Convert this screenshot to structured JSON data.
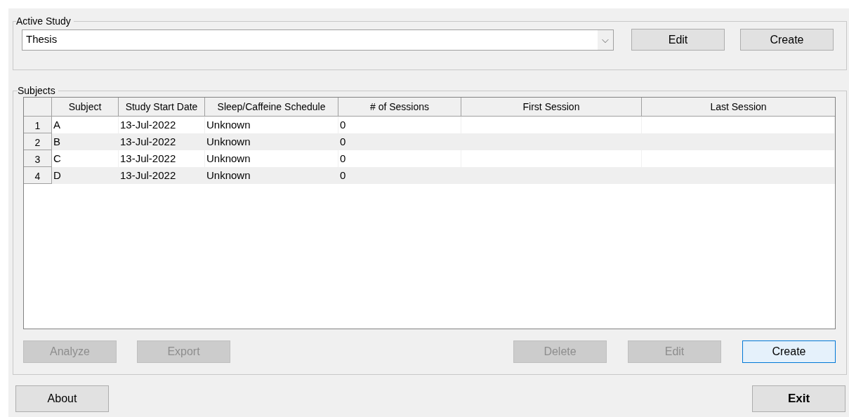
{
  "active_study": {
    "legend": "Active Study",
    "value": "Thesis",
    "dropdown_icon": "⌵",
    "buttons": [
      {
        "label": "Edit",
        "disabled": false,
        "focused": false
      },
      {
        "label": "Create",
        "disabled": false,
        "focused": false
      }
    ]
  },
  "subjects": {
    "legend": "Subjects",
    "table": {
      "columns": [
        "Subject",
        "Study Start Date",
        "Sleep/Caffeine Schedule",
        "# of Sessions",
        "First Session",
        "Last Session"
      ],
      "rows": [
        {
          "number": "1",
          "cells": [
            "A",
            "13-Jul-2022",
            "Unknown",
            "0",
            "",
            ""
          ]
        },
        {
          "number": "2",
          "cells": [
            "B",
            "13-Jul-2022",
            "Unknown",
            "0",
            "",
            ""
          ]
        },
        {
          "number": "3",
          "cells": [
            "C",
            "13-Jul-2022",
            "Unknown",
            "0",
            "",
            ""
          ]
        },
        {
          "number": "4",
          "cells": [
            "D",
            "13-Jul-2022",
            "Unknown",
            "0",
            "",
            ""
          ]
        }
      ]
    },
    "left_buttons": [
      {
        "label": "Analyze",
        "disabled": true,
        "focused": false
      },
      {
        "label": "Export",
        "disabled": true,
        "focused": false
      }
    ],
    "right_buttons": [
      {
        "label": "Delete",
        "disabled": true,
        "focused": false
      },
      {
        "label": "Edit",
        "disabled": true,
        "focused": false
      },
      {
        "label": "Create",
        "disabled": false,
        "focused": true
      }
    ]
  },
  "footer": {
    "about": "About",
    "exit": "Exit"
  }
}
